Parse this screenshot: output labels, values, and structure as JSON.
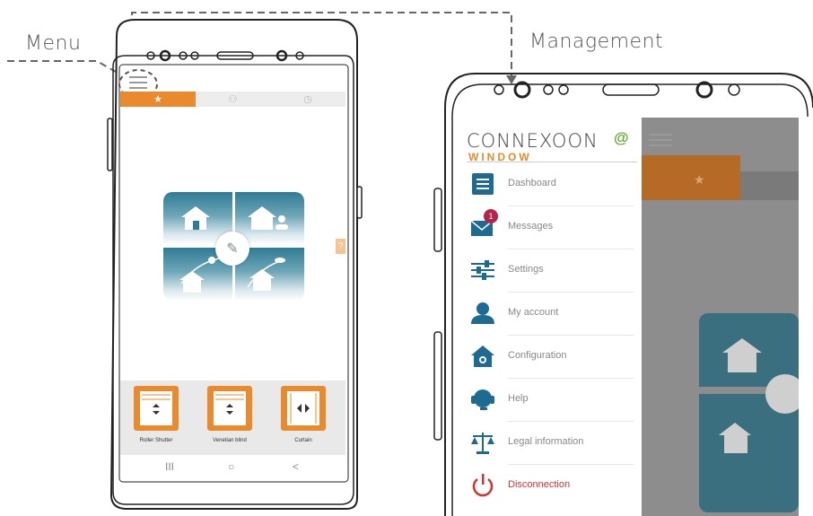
{
  "annotations": {
    "menu_label": "Menu",
    "management_label": "Management"
  },
  "left_phone": {
    "tabs": [
      {
        "icon": "star-icon",
        "active": true
      },
      {
        "icon": "people-icon",
        "active": false
      },
      {
        "icon": "clock-icon",
        "active": false
      }
    ],
    "help_label": "?",
    "devices": [
      {
        "label": "Roller Shutter",
        "icon": "roller-shutter-icon"
      },
      {
        "label": "Venetian blind",
        "icon": "venetian-blind-icon"
      },
      {
        "label": "Curtain",
        "icon": "curtain-icon"
      }
    ],
    "nav": {
      "recent": "III",
      "home": "○",
      "back": "<"
    }
  },
  "right_phone": {
    "logo": {
      "brand": "CONNEXOON",
      "sub": "WINDOW"
    },
    "menu_items": [
      {
        "label": "Dashboard",
        "icon": "dashboard-icon"
      },
      {
        "label": "Messages",
        "icon": "envelope-icon",
        "badge": "1"
      },
      {
        "label": "Settings",
        "icon": "sliders-icon"
      },
      {
        "label": "My account",
        "icon": "user-icon"
      },
      {
        "label": "Configuration",
        "icon": "house-gear-icon"
      },
      {
        "label": "Help",
        "icon": "headset-icon"
      },
      {
        "label": "Legal information",
        "icon": "scales-icon"
      },
      {
        "label": "Disconnection",
        "icon": "power-icon",
        "color": "#d6332f"
      }
    ]
  },
  "colors": {
    "orange": "#e98a2c",
    "teal": "#2f7c95",
    "menu_blue": "#1d6a93",
    "badge": "#b5234a",
    "red": "#d6332f"
  }
}
